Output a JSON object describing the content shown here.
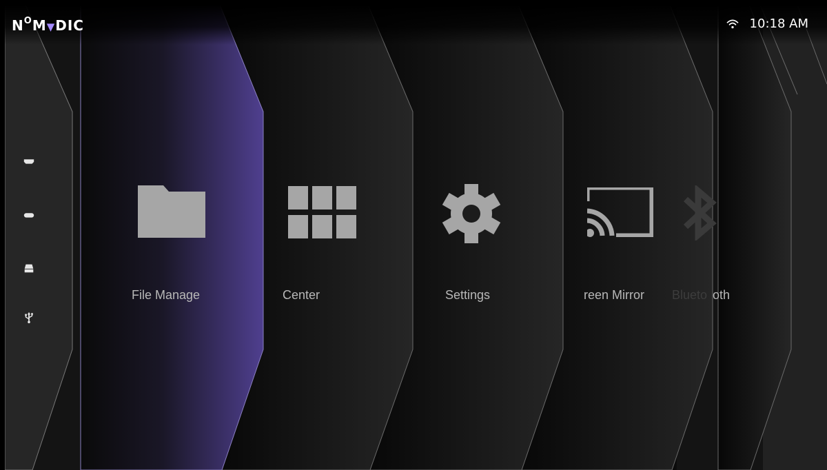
{
  "brand": {
    "logo_text": "NOMVDIC",
    "accent_color": "#a58bff"
  },
  "status_bar": {
    "time": "10:18 AM",
    "wifi_icon": "wifi-icon"
  },
  "source_sidebar": {
    "items": [
      {
        "name": "hdmi-1",
        "icon": "hdmi-icon"
      },
      {
        "name": "hdmi-2",
        "icon": "hdmi-icon"
      },
      {
        "name": "storage",
        "icon": "drive-icon"
      },
      {
        "name": "usb",
        "icon": "usb-icon"
      }
    ]
  },
  "home_tiles": [
    {
      "label": "File Manage",
      "icon": "folder-icon",
      "focused": true,
      "focus_color": "#4f3f8f"
    },
    {
      "label": "Center",
      "icon": "app-grid-icon"
    },
    {
      "label": "Settings",
      "icon": "gear-icon"
    },
    {
      "label": "reen Mirror",
      "icon": "cast-icon"
    },
    {
      "label": "Blueto",
      "icon": "bluetooth-icon"
    },
    {
      "label": "oth",
      "icon": ""
    }
  ]
}
